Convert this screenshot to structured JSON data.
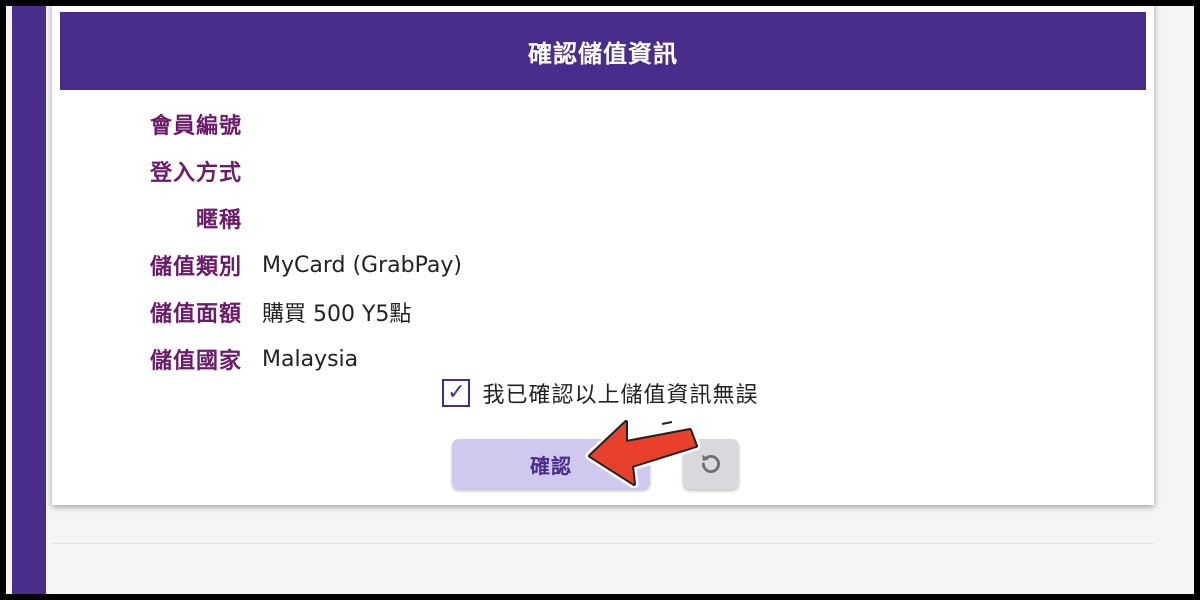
{
  "header": {
    "title": "確認儲值資訊"
  },
  "fields": [
    {
      "label": "會員編號",
      "value": ""
    },
    {
      "label": "登入方式",
      "value": ""
    },
    {
      "label": "暱稱",
      "value": ""
    },
    {
      "label": "儲值類別",
      "value": "MyCard (GrabPay)"
    },
    {
      "label": "儲值面額",
      "value": "購買 500 Y5點"
    },
    {
      "label": "儲值國家",
      "value": "Malaysia"
    }
  ],
  "confirmation": {
    "checked": true,
    "label": "我已確認以上儲值資訊無誤"
  },
  "buttons": {
    "confirm_label": "確認",
    "reset_icon": "reset-icon"
  },
  "colors": {
    "brand": "#4a2c8a",
    "label": "#6a1b6a",
    "confirm_button": "#cfc8ef",
    "arrow": "#e8402a"
  }
}
